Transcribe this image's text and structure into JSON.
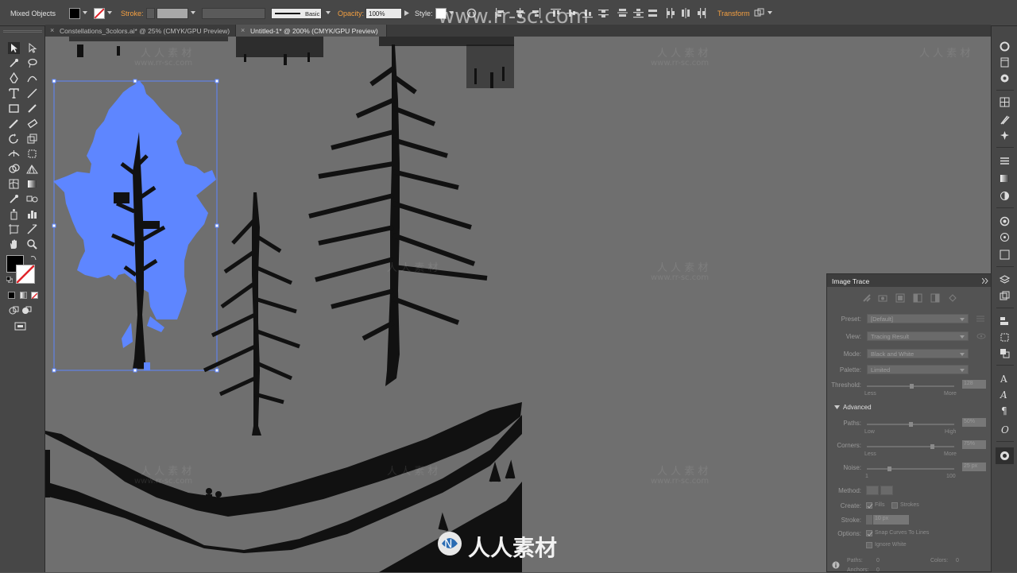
{
  "control_bar": {
    "selection_label": "Mixed Objects",
    "stroke_label": "Stroke:",
    "brush_label": "Basic",
    "opacity_label": "Opacity:",
    "opacity_value": "100%",
    "style_label": "Style:",
    "transform_label": "Transform"
  },
  "tabs": [
    {
      "label": "Constellations_3colors.ai* @ 25% (CMYK/GPU Preview)",
      "active": false
    },
    {
      "label": "Untitled-1* @ 200% (CMYK/GPU Preview)",
      "active": true
    }
  ],
  "watermark": {
    "site": "www.rr-sc.com",
    "brand": "人人素材",
    "small_cn": "人 人 素 材",
    "small_en": "www.rr-sc.com"
  },
  "image_trace": {
    "title": "Image Trace",
    "preset_label": "Preset:",
    "preset_value": "[Default]",
    "view_label": "View:",
    "view_value": "Tracing Result",
    "mode_label": "Mode:",
    "mode_value": "Black and White",
    "palette_label": "Palette:",
    "palette_value": "Limited",
    "threshold_label": "Threshold:",
    "threshold_value": "128",
    "threshold_min": "Less",
    "threshold_max": "More",
    "advanced_label": "Advanced",
    "paths_label": "Paths:",
    "paths_value": "50%",
    "paths_min": "Low",
    "paths_max": "High",
    "corners_label": "Corners:",
    "corners_value": "75%",
    "corners_min": "Less",
    "corners_max": "More",
    "noise_label": "Noise:",
    "noise_value": "25 px",
    "noise_min": "1",
    "noise_max": "100",
    "method_label": "Method:",
    "create_label": "Create:",
    "fills_label": "Fills",
    "strokes_label": "Strokes",
    "stroke_label": "Stroke:",
    "stroke_value": "10 px",
    "options_label": "Options:",
    "snap_label": "Snap Curves To Lines",
    "ignore_white_label": "Ignore White",
    "paths_stat_label": "Paths:",
    "paths_stat_value": "0",
    "colors_stat_label": "Colors:",
    "colors_stat_value": "0",
    "anchors_stat_label": "Anchors:",
    "anchors_stat_value": "0"
  },
  "colors": {
    "selection": "#5e86ff",
    "transform_link": "#f5a041",
    "canvas": "#6f6f6f"
  }
}
